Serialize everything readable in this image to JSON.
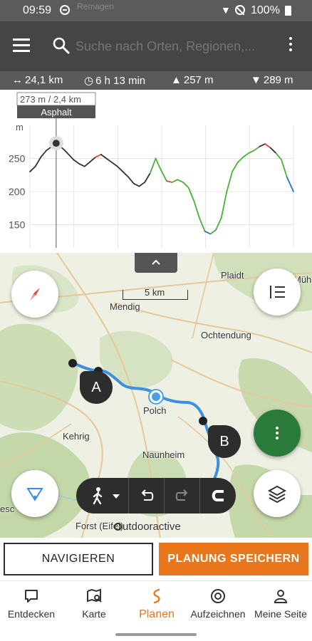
{
  "status_bar": {
    "time": "09:59",
    "ghost_text": "Remagen",
    "battery": "100%"
  },
  "app_bar": {
    "search_placeholder": "Suche nach Orten, Regionen,..."
  },
  "stats": {
    "distance": "24,1 km",
    "duration": "6 h 13 min",
    "ascent": "257 m",
    "descent": "289 m"
  },
  "elevation_profile": {
    "unit_label": "m",
    "cursor_readout": "273 m / 2,4 km",
    "cursor_surface": "Asphalt",
    "colors": {
      "asphalt": "#333333",
      "path": "#4caf3a",
      "steep": "#e0433a",
      "trail": "#2d6fd6"
    }
  },
  "chart_data": {
    "type": "line",
    "xlabel": "",
    "ylabel": "m",
    "y_ticks": [
      150,
      200,
      250
    ],
    "ylim": [
      115,
      300
    ],
    "xlim": [
      0,
      24.1
    ],
    "x": [
      0,
      0.5,
      1.0,
      1.5,
      2.0,
      2.4,
      2.8,
      3.2,
      3.6,
      4.0,
      4.5,
      5.0,
      5.5,
      6.0,
      6.5,
      7.0,
      7.5,
      8.0,
      8.5,
      9.0,
      9.5,
      10.0,
      10.5,
      11.0,
      11.5,
      12.0,
      12.5,
      13.0,
      13.5,
      14.0,
      14.5,
      15.0,
      15.5,
      16.0,
      16.5,
      17.0,
      17.5,
      18.0,
      18.5,
      19.0,
      19.5,
      20.0,
      20.5,
      21.0,
      21.5,
      22.0,
      22.5,
      23.0,
      23.5,
      24.1
    ],
    "y": [
      230,
      238,
      252,
      262,
      268,
      273,
      268,
      262,
      255,
      248,
      242,
      238,
      245,
      252,
      256,
      250,
      244,
      238,
      230,
      222,
      212,
      208,
      214,
      228,
      250,
      232,
      216,
      214,
      218,
      214,
      206,
      186,
      160,
      140,
      136,
      142,
      160,
      200,
      230,
      244,
      252,
      258,
      262,
      268,
      272,
      266,
      258,
      248,
      222,
      200
    ],
    "cursor_x": 2.4,
    "cursor_y": 273
  },
  "map": {
    "places": {
      "plaidt": "Plaidt",
      "mendig": "Mendig",
      "ochtendung": "Ochtendung",
      "polch": "Polch",
      "kehrig": "Kehrig",
      "naunheim": "Naunheim",
      "forst": "Forst (Eifel)",
      "muelheim": "Müh",
      "esc": "esc"
    },
    "scale_label": "5 km",
    "marker_a": "A",
    "marker_b": "B",
    "brand": "utdooractive"
  },
  "actions": {
    "navigate": "NAVIGIEREN",
    "save": "PLANUNG SPEICHERN"
  },
  "bottom_nav": [
    {
      "label": "Entdecken",
      "icon": "speech-bubble-icon"
    },
    {
      "label": "Karte",
      "icon": "map-search-icon"
    },
    {
      "label": "Planen",
      "icon": "route-plan-icon",
      "active": true
    },
    {
      "label": "Aufzeichnen",
      "icon": "record-icon"
    },
    {
      "label": "Meine Seite",
      "icon": "person-icon"
    }
  ]
}
